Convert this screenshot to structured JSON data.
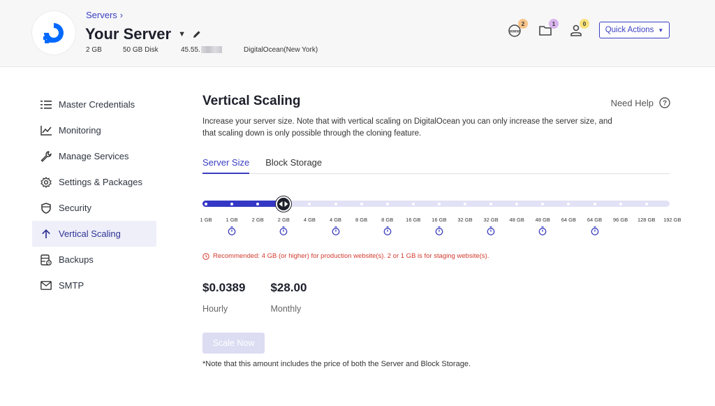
{
  "header": {
    "breadcrumb": "Servers",
    "server_name": "Your Server",
    "meta": {
      "ram": "2 GB",
      "disk": "50 GB Disk",
      "ip_prefix": "45.55.",
      "provider": "DigitalOcean(New York)"
    },
    "badges": {
      "domains": "2",
      "files": "1",
      "users": "0"
    },
    "quick_actions": "Quick Actions"
  },
  "sidebar": {
    "items": [
      {
        "label": "Master Credentials",
        "icon": "list-icon"
      },
      {
        "label": "Monitoring",
        "icon": "chart-line-icon"
      },
      {
        "label": "Manage Services",
        "icon": "wrench-icon"
      },
      {
        "label": "Settings & Packages",
        "icon": "gear-icon"
      },
      {
        "label": "Security",
        "icon": "shield-icon"
      },
      {
        "label": "Vertical Scaling",
        "icon": "arrow-up-icon",
        "active": true
      },
      {
        "label": "Backups",
        "icon": "backup-icon"
      },
      {
        "label": "SMTP",
        "icon": "mail-icon"
      }
    ]
  },
  "main": {
    "title": "Vertical Scaling",
    "need_help": "Need Help",
    "description": "Increase your server size. Note that with vertical scaling on DigitalOcean you can only increase the server size, and that scaling down is only possible through the cloning feature.",
    "tabs": [
      {
        "label": "Server Size",
        "active": true
      },
      {
        "label": "Block Storage"
      }
    ],
    "slider": {
      "selected_index": 3,
      "stops": [
        {
          "label": "1 GB",
          "timer": false
        },
        {
          "label": "1 GB",
          "timer": true
        },
        {
          "label": "2 GB",
          "timer": false
        },
        {
          "label": "2 GB",
          "timer": true
        },
        {
          "label": "4 GB",
          "timer": false
        },
        {
          "label": "4 GB",
          "timer": true
        },
        {
          "label": "8 GB",
          "timer": false
        },
        {
          "label": "8 GB",
          "timer": true
        },
        {
          "label": "16 GB",
          "timer": false
        },
        {
          "label": "16 GB",
          "timer": true
        },
        {
          "label": "32 GB",
          "timer": false
        },
        {
          "label": "32 GB",
          "timer": true
        },
        {
          "label": "48 GB",
          "timer": false
        },
        {
          "label": "48 GB",
          "timer": true
        },
        {
          "label": "64 GB",
          "timer": false
        },
        {
          "label": "64 GB",
          "timer": true
        },
        {
          "label": "96 GB",
          "timer": false
        },
        {
          "label": "128 GB",
          "timer": false
        },
        {
          "label": "192 GB",
          "timer": false
        }
      ]
    },
    "recommendation": "Recommended: 4 GB (or higher) for production website(s). 2 or 1 GB is for staging website(s).",
    "prices": {
      "hourly_value": "$0.0389",
      "hourly_label": "Hourly",
      "monthly_value": "$28.00",
      "monthly_label": "Monthly"
    },
    "scale_button": "Scale Now",
    "note": "*Note that this amount includes the price of both the Server and Block Storage."
  },
  "colors": {
    "accent": "#3b3fc1",
    "slider_fill": "#3438c4",
    "slider_track": "#e2e2f6",
    "warning": "#d23a2e",
    "badge_domains": "#f6c48a",
    "badge_files": "#d8b4ec",
    "badge_users": "#f7e27a"
  }
}
